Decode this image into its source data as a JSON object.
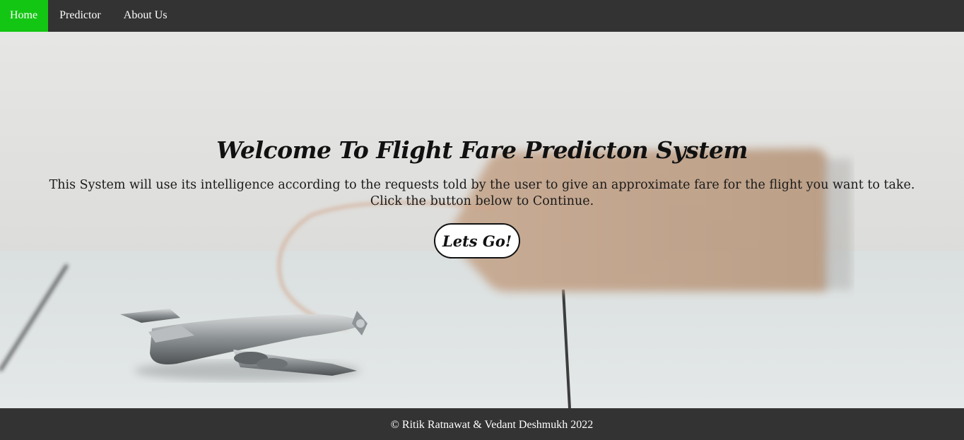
{
  "nav": {
    "items": [
      {
        "label": "Home",
        "active": true
      },
      {
        "label": "Predictor",
        "active": false
      },
      {
        "label": "About Us",
        "active": false
      }
    ],
    "active_color": "#14c614",
    "bar_color": "#333333"
  },
  "hero": {
    "title": "Welcome To Flight Fare Predicton System",
    "description_line1": "This System will use its intelligence according to the requests told by the user to give an approximate fare for the flight you want to take.",
    "description_line2": "Click the button below to Continue.",
    "button_label": "Lets Go!",
    "background_image": "toy airplane with luggage tag on white wooden table"
  },
  "footer": {
    "text": "© Ritik Ratnawat & Vedant Deshmukh 2022"
  }
}
